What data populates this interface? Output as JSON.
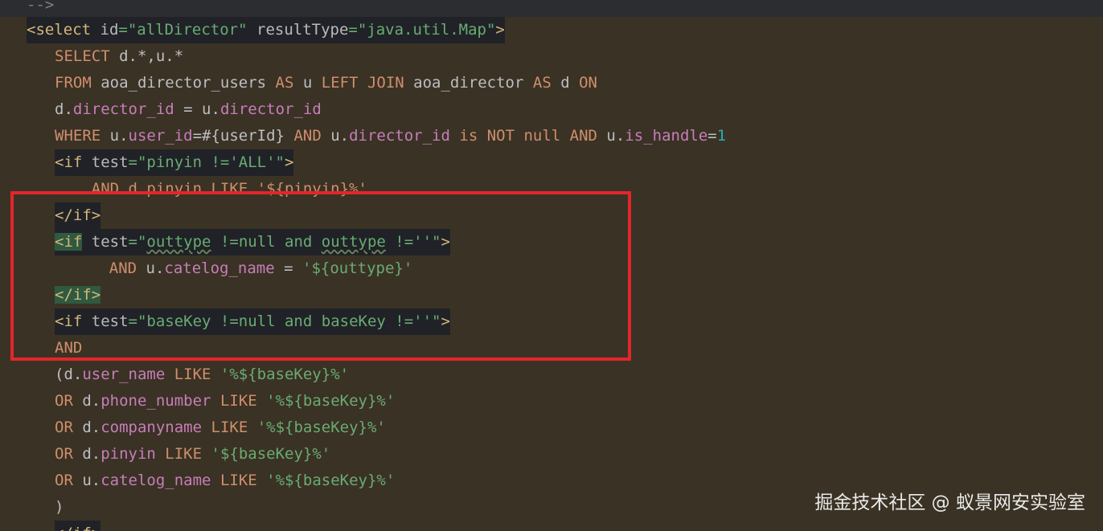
{
  "editor": {
    "lines": [
      {
        "tokens": [
          {
            "t": "-->",
            "c": "c-comment"
          }
        ]
      },
      {
        "tokens": [
          {
            "t": "<select ",
            "c": "c-tag"
          },
          {
            "t": "id",
            "c": "c-attr"
          },
          {
            "t": "=\"allDirector\" ",
            "c": "c-val"
          },
          {
            "t": "resultType",
            "c": "c-attr"
          },
          {
            "t": "=\"java.util.Map\"",
            "c": "c-val"
          },
          {
            "t": ">",
            "c": "c-tag"
          }
        ],
        "bg": "hl"
      },
      {
        "tokens": [
          {
            "t": "SELECT ",
            "c": "c-kw"
          },
          {
            "t": "d.*,u.*",
            "c": "c-id"
          }
        ]
      },
      {
        "tokens": [
          {
            "t": "FROM ",
            "c": "c-kw"
          },
          {
            "t": "aoa_director_users ",
            "c": "c-id"
          },
          {
            "t": "AS ",
            "c": "c-kw"
          },
          {
            "t": "u ",
            "c": "c-id"
          },
          {
            "t": "LEFT JOIN ",
            "c": "c-kw"
          },
          {
            "t": "aoa_director ",
            "c": "c-id"
          },
          {
            "t": "AS ",
            "c": "c-kw"
          },
          {
            "t": "d ",
            "c": "c-id"
          },
          {
            "t": "ON",
            "c": "c-kw"
          }
        ]
      },
      {
        "tokens": [
          {
            "t": "d.",
            "c": "c-id"
          },
          {
            "t": "director_id",
            "c": "c-field"
          },
          {
            "t": " = u.",
            "c": "c-id"
          },
          {
            "t": "director_id",
            "c": "c-field"
          }
        ]
      },
      {
        "tokens": [
          {
            "t": "WHERE ",
            "c": "c-kw"
          },
          {
            "t": "u.",
            "c": "c-id"
          },
          {
            "t": "user_id",
            "c": "c-field"
          },
          {
            "t": "=#{userId} ",
            "c": "c-id"
          },
          {
            "t": "AND ",
            "c": "c-kw"
          },
          {
            "t": "u.",
            "c": "c-id"
          },
          {
            "t": "director_id ",
            "c": "c-field"
          },
          {
            "t": "is NOT null AND ",
            "c": "c-kw"
          },
          {
            "t": "u.",
            "c": "c-id"
          },
          {
            "t": "is_handle",
            "c": "c-field"
          },
          {
            "t": "=",
            "c": "c-id"
          },
          {
            "t": "1",
            "c": "c-num"
          }
        ]
      },
      {
        "tokens": [
          {
            "t": "<if ",
            "c": "c-tag"
          },
          {
            "t": "test",
            "c": "c-attr"
          },
          {
            "t": "=\"pinyin !='ALL'\"",
            "c": "c-val"
          },
          {
            "t": ">",
            "c": "c-tag"
          }
        ],
        "bg": "hl"
      },
      {
        "tokens": [
          {
            "t": "    AND d.pinyin LIKE '${pinyin}%'",
            "c": "c-kw"
          }
        ]
      },
      {
        "tokens": [
          {
            "t": "</if>",
            "c": "c-tag"
          }
        ],
        "bg": "hl"
      },
      {
        "tokens": [
          {
            "t": "<if",
            "c": "c-tag",
            "bg": "hl-green"
          },
          {
            "t": " test",
            "c": "c-attr"
          },
          {
            "t": "=\"",
            "c": "c-val"
          },
          {
            "t": "outtype",
            "c": "c-val",
            "sq": true
          },
          {
            "t": " !=null and ",
            "c": "c-val"
          },
          {
            "t": "outtype",
            "c": "c-val",
            "sq": true
          },
          {
            "t": " !=''\"",
            "c": "c-val"
          },
          {
            "t": ">",
            "c": "c-tag"
          }
        ],
        "bg": "hl"
      },
      {
        "tokens": [
          {
            "t": "    AND ",
            "c": "c-kw"
          },
          {
            "t": "u.",
            "c": "c-id"
          },
          {
            "t": "catelog_name",
            "c": "c-field"
          },
          {
            "t": " = ",
            "c": "c-id"
          },
          {
            "t": "'${outtype}'",
            "c": "c-str"
          }
        ]
      },
      {
        "tokens": [
          {
            "t": "</if>",
            "c": "c-tag",
            "bg": "hl-green"
          }
        ]
      },
      {
        "tokens": [
          {
            "t": "<if ",
            "c": "c-tag"
          },
          {
            "t": "test",
            "c": "c-attr"
          },
          {
            "t": "=\"baseKey !=null and baseKey !=''\"",
            "c": "c-val"
          },
          {
            "t": ">",
            "c": "c-tag"
          }
        ],
        "bg": "hl"
      },
      {
        "tokens": [
          {
            "t": "AND",
            "c": "c-kw"
          }
        ]
      },
      {
        "tokens": [
          {
            "t": "(d.",
            "c": "c-id"
          },
          {
            "t": "user_name ",
            "c": "c-field"
          },
          {
            "t": "LIKE ",
            "c": "c-kw"
          },
          {
            "t": "'%${baseKey}%'",
            "c": "c-str"
          }
        ]
      },
      {
        "tokens": [
          {
            "t": "OR ",
            "c": "c-kw"
          },
          {
            "t": "d.",
            "c": "c-id"
          },
          {
            "t": "phone_number ",
            "c": "c-field"
          },
          {
            "t": "LIKE ",
            "c": "c-kw"
          },
          {
            "t": "'%${baseKey}%'",
            "c": "c-str"
          }
        ]
      },
      {
        "tokens": [
          {
            "t": "OR ",
            "c": "c-kw"
          },
          {
            "t": "d.",
            "c": "c-id"
          },
          {
            "t": "companyname ",
            "c": "c-field"
          },
          {
            "t": "LIKE ",
            "c": "c-kw"
          },
          {
            "t": "'%${baseKey}%'",
            "c": "c-str"
          }
        ]
      },
      {
        "tokens": [
          {
            "t": "OR ",
            "c": "c-kw"
          },
          {
            "t": "d.",
            "c": "c-id"
          },
          {
            "t": "pinyin ",
            "c": "c-field"
          },
          {
            "t": "LIKE ",
            "c": "c-kw"
          },
          {
            "t": "'${baseKey}%'",
            "c": "c-str"
          }
        ]
      },
      {
        "tokens": [
          {
            "t": "OR ",
            "c": "c-kw"
          },
          {
            "t": "u.",
            "c": "c-id"
          },
          {
            "t": "catelog_name ",
            "c": "c-field"
          },
          {
            "t": "LIKE ",
            "c": "c-kw"
          },
          {
            "t": "'%${baseKey}%'",
            "c": "c-str"
          }
        ]
      },
      {
        "tokens": [
          {
            "t": ")",
            "c": "c-id"
          }
        ]
      },
      {
        "tokens": [
          {
            "t": "</if>",
            "c": "c-tag"
          }
        ],
        "bg": "hl"
      }
    ]
  },
  "watermark": {
    "text": "掘金技术社区 @ 蚁景网安实验室"
  },
  "colors": {
    "background": "#3a3224",
    "highlight_box": "#e3262b"
  }
}
